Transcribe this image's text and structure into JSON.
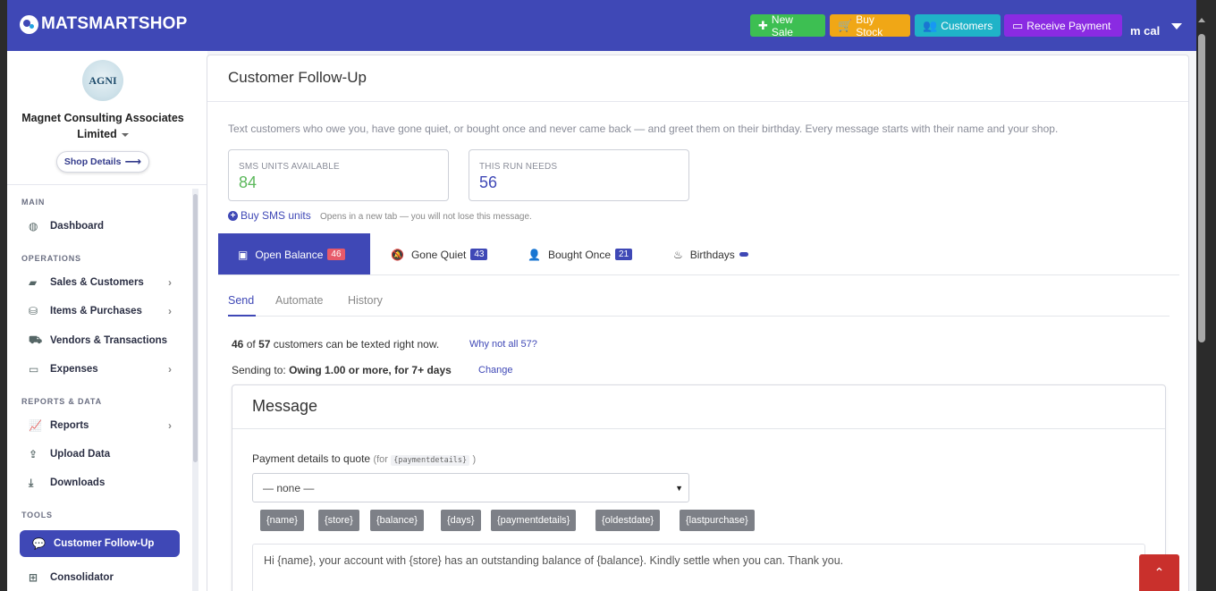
{
  "brand": {
    "name": "MATSMARTSHOP"
  },
  "header": {
    "buttons": [
      {
        "label": "New Sale",
        "icon": "plus-icon",
        "color": "#3dbf52"
      },
      {
        "label": "Buy Stock",
        "icon": "cart-icon",
        "color": "#f0a716"
      },
      {
        "label": "Customers",
        "icon": "users-icon",
        "color": "#1fb3c8"
      },
      {
        "label": "Receive Payment",
        "icon": "credit-card-icon",
        "color": "#8a2be2"
      }
    ],
    "user": "m cal"
  },
  "sidebar": {
    "org_logo_text": "AGNI",
    "org_name": "Magnet Consulting Associates Limited",
    "shop_details": "Shop Details",
    "sections": {
      "main": "MAIN",
      "operations": "OPERATIONS",
      "reports": "REPORTS & DATA",
      "tools": "TOOLS"
    },
    "items": {
      "dashboard": "Dashboard",
      "sales": "Sales & Customers",
      "items": "Items & Purchases",
      "vendors": "Vendors & Transactions",
      "expenses": "Expenses",
      "reports": "Reports",
      "upload": "Upload Data",
      "downloads": "Downloads",
      "followup": "Customer Follow-Up",
      "consolidator": "Consolidator"
    }
  },
  "main": {
    "title": "Customer Follow-Up",
    "description": "Text customers who owe you, have gone quiet, or bought once and never came back — and greet them on their birthday. Every message starts with their name and your shop.",
    "stats": [
      {
        "label": "SMS UNITS AVAILABLE",
        "value": "84",
        "color": "#5cb85c"
      },
      {
        "label": "THIS RUN NEEDS",
        "value": "56",
        "color": "#3f48b6"
      }
    ],
    "buy_sms": "Buy SMS units",
    "buy_sms_note": "Opens in a new tab — you will not lose this message.",
    "tabs": [
      {
        "label": "Open Balance",
        "count": "46"
      },
      {
        "label": "Gone Quiet",
        "count": "43"
      },
      {
        "label": "Bought Once",
        "count": "21"
      },
      {
        "label": "Birthdays",
        "count": ""
      }
    ],
    "subtabs": [
      "Send",
      "Automate",
      "History"
    ],
    "reach": {
      "sendable": "46",
      "of": "of",
      "total": "57",
      "suffix": "customers can be texted right now.",
      "why": "Why not all 57?"
    },
    "sending_to": {
      "prefix": "Sending to:",
      "criteria": "Owing  1.00 or more, for 7+ days",
      "change": "Change"
    },
    "message": {
      "title": "Message",
      "payment_label": "Payment details to quote",
      "payment_for_prefix": "(for",
      "payment_for_code": "{paymentdetails}",
      "payment_for_suffix": ")",
      "select_value": "— none —",
      "tokens": [
        "{name}",
        "{store}",
        "{balance}",
        "{days}",
        "{paymentdetails}",
        "{oldestdate}",
        "{lastpurchase}"
      ],
      "body": "Hi {name}, your account with {store} has an outstanding balance of {balance}. Kindly settle when you can. Thank you."
    }
  }
}
